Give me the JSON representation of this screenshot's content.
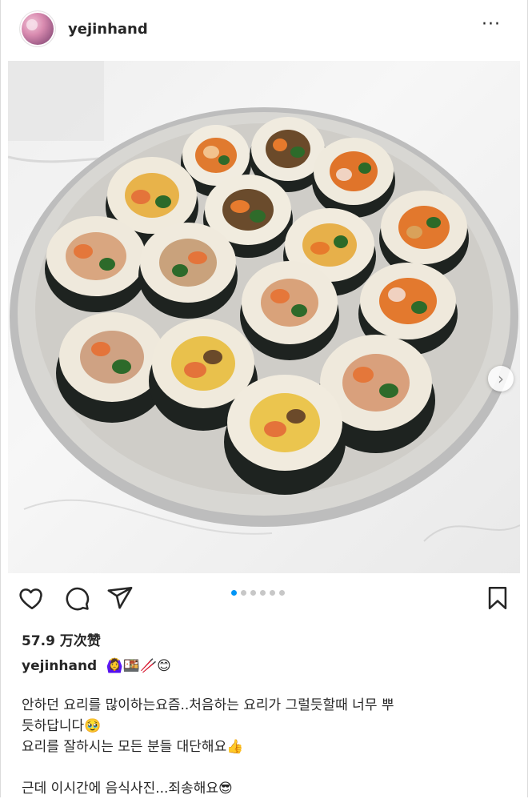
{
  "post": {
    "username": "yejinhand",
    "more_label": "···"
  },
  "image": {
    "description_icon": "kimbap-photo",
    "carousel_count": 6,
    "carousel_active_index": 0,
    "next_icon": "chevron-right-icon"
  },
  "actions": {
    "like_icon": "heart-icon",
    "comment_icon": "comment-icon",
    "share_icon": "send-icon",
    "save_icon": "bookmark-icon"
  },
  "likes": {
    "label": "57.9 万次赞"
  },
  "caption": {
    "username": "yejinhand",
    "emoji": "🙆‍♀️🍱🥢😊",
    "lines": [
      "안하던 요리를 많이하는요즘..처음하는 요리가 그럴듯할때 너무 뿌",
      "듯하답니다🥹",
      "요리를 잘하시는 모든 분들 대단해요👍",
      "",
      "근데 이시간에 음식사진...죄송해요😎"
    ]
  },
  "colors": {
    "accent_blue": "#0095f6",
    "text": "#262626",
    "border": "#dbdbdb"
  }
}
